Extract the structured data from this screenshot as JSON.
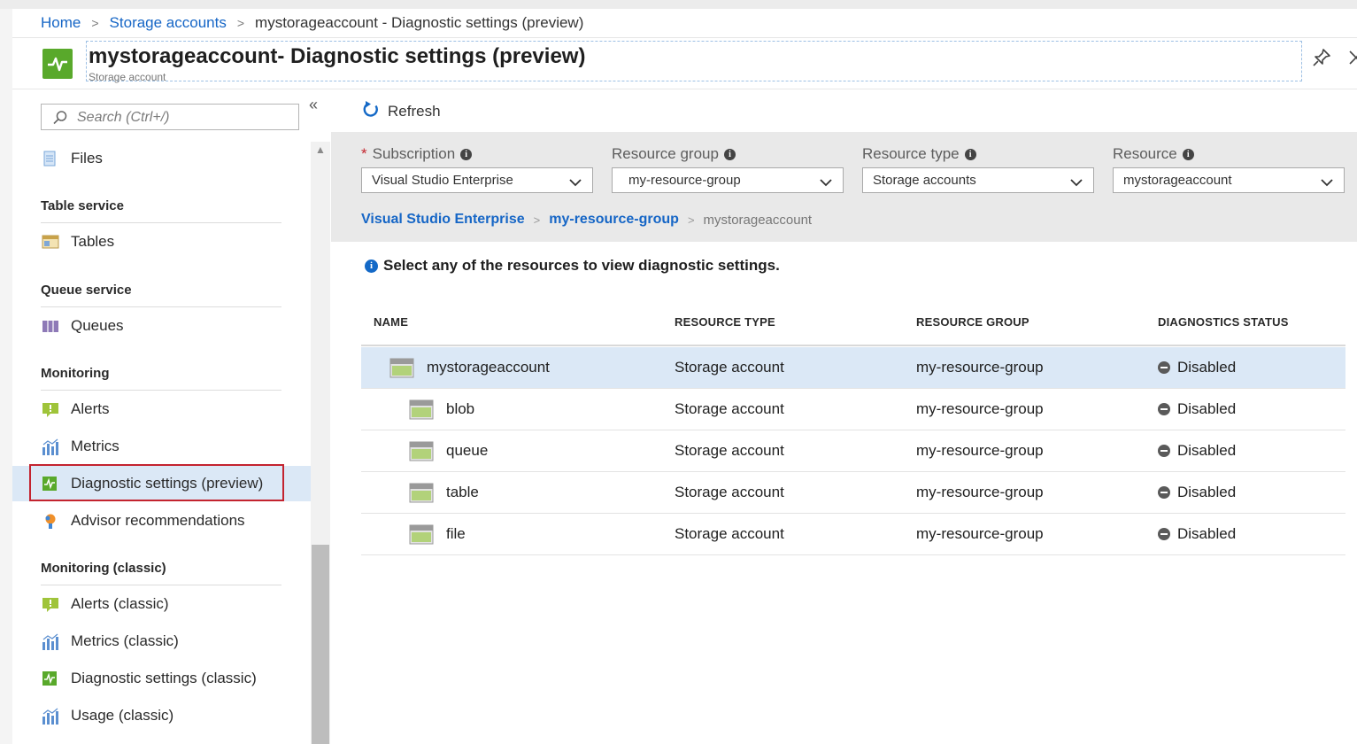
{
  "breadcrumb": {
    "home": "Home",
    "storage_accounts": "Storage accounts",
    "current": "mystorageaccount - Diagnostic settings (preview)"
  },
  "header": {
    "title": "mystorageaccount- Diagnostic settings (preview)",
    "subtitle": "Storage account",
    "icon": "diagnostic-pulse-icon"
  },
  "sidebar": {
    "search_placeholder": "Search (Ctrl+/)",
    "collapse_glyph": "«",
    "items": [
      {
        "label": "Files",
        "icon": "files-icon"
      },
      {
        "label": "Tables",
        "icon": "tables-icon"
      },
      {
        "label": "Queues",
        "icon": "queues-icon"
      },
      {
        "label": "Alerts",
        "icon": "alerts-icon"
      },
      {
        "label": "Metrics",
        "icon": "metrics-icon"
      },
      {
        "label": "Diagnostic settings (preview)",
        "icon": "diagnostic-icon"
      },
      {
        "label": "Advisor recommendations",
        "icon": "advisor-icon"
      },
      {
        "label": "Alerts (classic)",
        "icon": "alerts-icon"
      },
      {
        "label": "Metrics (classic)",
        "icon": "metrics-icon"
      },
      {
        "label": "Diagnostic settings (classic)",
        "icon": "diagnostic-icon"
      },
      {
        "label": "Usage (classic)",
        "icon": "metrics-icon"
      }
    ],
    "sections": {
      "table": "Table service",
      "queue": "Queue service",
      "monitoring": "Monitoring",
      "monitoring_classic": "Monitoring (classic)"
    }
  },
  "toolbar": {
    "refresh_label": "Refresh"
  },
  "filters": {
    "subscription": {
      "label": "Subscription",
      "value": "Visual Studio Enterprise",
      "required": true
    },
    "resource_group": {
      "label": "Resource group",
      "value": "my-resource-group"
    },
    "resource_type": {
      "label": "Resource type",
      "value": "Storage accounts"
    },
    "resource": {
      "label": "Resource",
      "value": "mystorageaccount"
    }
  },
  "resource_breadcrumb": {
    "subscription": "Visual Studio Enterprise",
    "group": "my-resource-group",
    "resource": "mystorageaccount"
  },
  "hint": "Select any of the resources to view diagnostic settings.",
  "table": {
    "headers": [
      "NAME",
      "RESOURCE TYPE",
      "RESOURCE GROUP",
      "DIAGNOSTICS STATUS"
    ],
    "rows": [
      {
        "name": "mystorageaccount",
        "type": "Storage account",
        "group": "my-resource-group",
        "status": "Disabled"
      },
      {
        "name": "blob",
        "type": "Storage account",
        "group": "my-resource-group",
        "status": "Disabled"
      },
      {
        "name": "queue",
        "type": "Storage account",
        "group": "my-resource-group",
        "status": "Disabled"
      },
      {
        "name": "table",
        "type": "Storage account",
        "group": "my-resource-group",
        "status": "Disabled"
      },
      {
        "name": "file",
        "type": "Storage account",
        "group": "my-resource-group",
        "status": "Disabled"
      }
    ]
  },
  "colors": {
    "link": "#1666c6",
    "selected_bg": "#dbe8f6",
    "highlight_border": "#c3232f",
    "brand_green": "#59a92b",
    "filter_bg": "#e9e9e9"
  }
}
